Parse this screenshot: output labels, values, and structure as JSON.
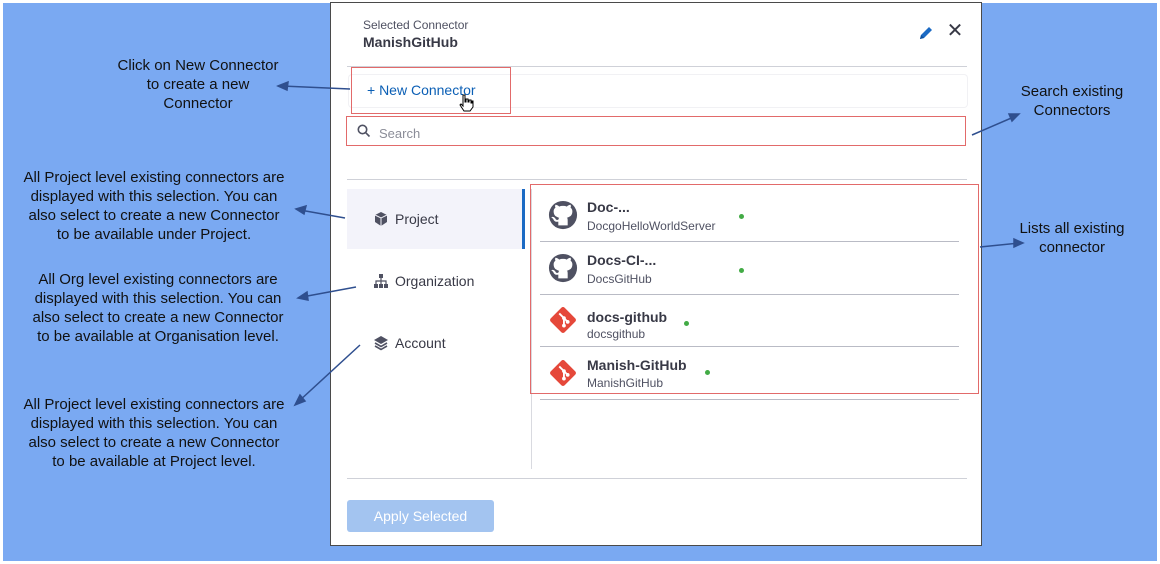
{
  "annotations": {
    "new_connector": "Click on New Connector\nto create a new\nConnector",
    "project_level": "All Project level existing connectors are\ndisplayed with this selection. You can\nalso select to create a new Connector\nto be available under Project.",
    "org_level": "All Org level existing connectors are\ndisplayed with this selection. You can\nalso select to create a new Connector\nto be available at Organisation level.",
    "account_level": "All Project level existing connectors are\ndisplayed with this selection. You can\nalso select to create a new Connector\nto be available at Project level.",
    "search": "Search existing\nConnectors",
    "list": "Lists all existing\nconnector"
  },
  "modal": {
    "selected_label": "Selected Connector",
    "selected_name": "ManishGitHub",
    "new_connector_label": "+ New Connector",
    "search_placeholder": "Search",
    "apply_label": "Apply Selected"
  },
  "scopes": [
    {
      "label": "Project",
      "icon": "cube-icon",
      "active": true
    },
    {
      "label": "Organization",
      "icon": "org-tree-icon",
      "active": false
    },
    {
      "label": "Account",
      "icon": "layers-icon",
      "active": false
    }
  ],
  "connectors": [
    {
      "name": "Doc-...",
      "id": "DocgoHelloWorldServer",
      "icon": "github-icon",
      "status": "connected"
    },
    {
      "name": "Docs-CI-...",
      "id": "DocsGitHub",
      "icon": "github-icon",
      "status": "connected"
    },
    {
      "name": "docs-github",
      "id": "docsgithub",
      "icon": "git-icon",
      "status": "connected"
    },
    {
      "name": "Manish-GitHub",
      "id": "ManishGitHub",
      "icon": "git-icon",
      "status": "connected"
    }
  ],
  "colors": {
    "background": "#7aa9f2",
    "highlight": "#e26a6a",
    "link": "#0b5fb5",
    "status": "#42ab45",
    "git_brand": "#e5483a"
  }
}
